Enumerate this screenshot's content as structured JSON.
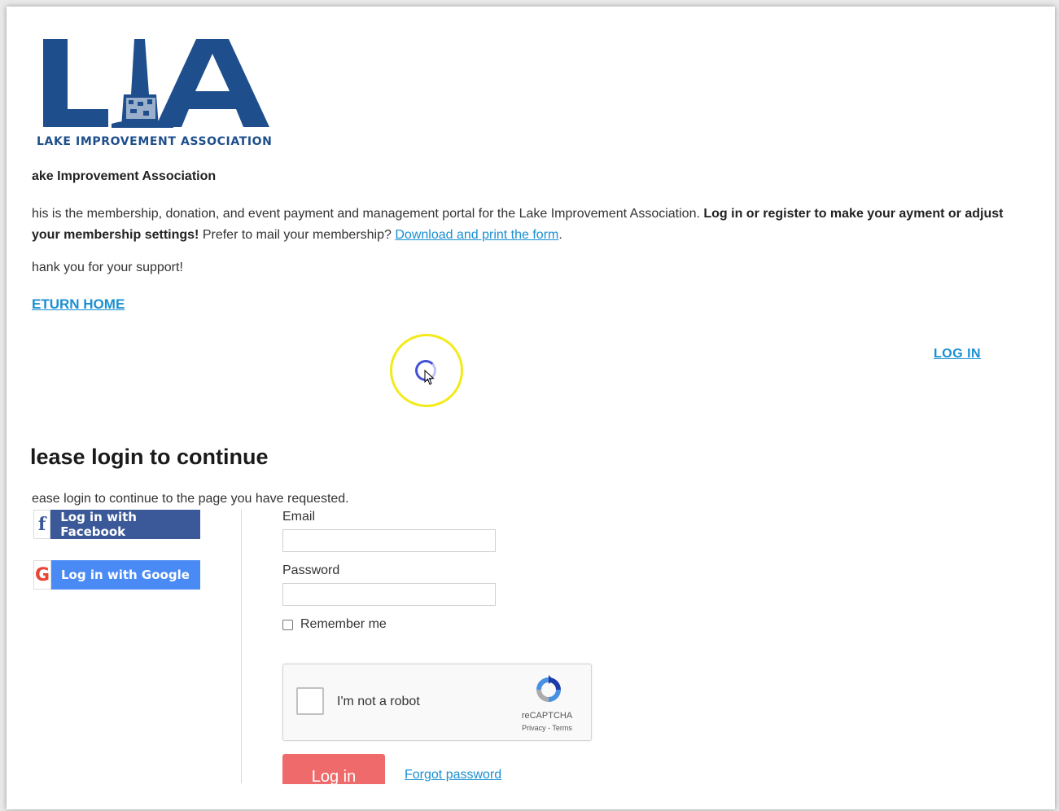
{
  "logo": {
    "letters": "LIA",
    "caption": "LAKE IMPROVEMENT ASSOCIATION"
  },
  "org_title": "ake Improvement Association",
  "intro": {
    "text_start": "his is the membership, donation, and event payment and management portal for the Lake Improvement Association. ",
    "bold": "Log in or register to make your ayment or adjust your membership settings!",
    "text_end": " Prefer to mail your membership? ",
    "link": "Download and print the form",
    "period": "."
  },
  "thanks": "hank you for your support!",
  "return_home": "ETURN HOME",
  "top_login": "LOG IN",
  "login": {
    "heading": "lease login to continue",
    "subtitle": "ease login to continue to the page you have requested.",
    "facebook_label": "Log in with Facebook",
    "google_label": "Log in with Google",
    "email_label": "Email",
    "password_label": "Password",
    "remember_label": "Remember me",
    "submit_label": "Log in",
    "forgot_label": "Forgot password"
  },
  "recaptcha": {
    "text": "I'm not a robot",
    "brand": "reCAPTCHA",
    "links": "Privacy - Terms"
  },
  "icons": {
    "facebook": "facebook-icon",
    "google": "google-icon",
    "recaptcha": "recaptcha-icon",
    "spinner": "loading-spinner-icon",
    "cursor": "mouse-cursor-icon"
  },
  "colors": {
    "brand_blue": "#1e4f8c",
    "link_blue": "#1a8fd1",
    "facebook_blue": "#3b5998",
    "google_blue": "#4a8af4",
    "login_red": "#ef6b6b",
    "highlight_yellow": "#f3ea1a"
  }
}
